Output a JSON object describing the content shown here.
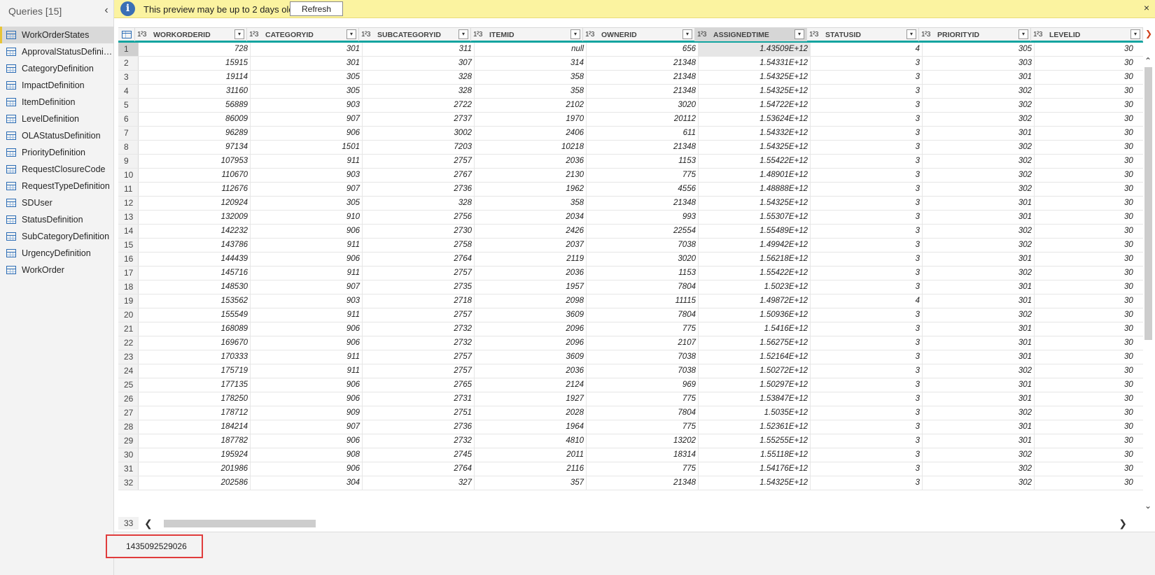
{
  "queries_header": "Queries [15]",
  "queries": [
    "WorkOrderStates",
    "ApprovalStatusDefiniti...",
    "CategoryDefinition",
    "ImpactDefinition",
    "ItemDefinition",
    "LevelDefinition",
    "OLAStatusDefinition",
    "PriorityDefinition",
    "RequestClosureCode",
    "RequestTypeDefinition",
    "SDUser",
    "StatusDefinition",
    "SubCategoryDefinition",
    "UrgencyDefinition",
    "WorkOrder"
  ],
  "selected_query": "WorkOrderStates",
  "info_bar": {
    "text": "This preview may be up to 2 days old.",
    "refresh_label": "Refresh",
    "close_glyph": "×"
  },
  "columns": [
    "WORKORDERID",
    "CATEGORYID",
    "SUBCATEGORYID",
    "ITEMID",
    "OWNERID",
    "ASSIGNEDTIME",
    "STATUSID",
    "PRIORITYID",
    "LEVELID"
  ],
  "active_column": "ASSIGNEDTIME",
  "type_glyph": "1²3",
  "rows": [
    [
      "1",
      "728",
      "301",
      "311",
      "null",
      "656",
      "1.43509E+12",
      "4",
      "305",
      "30"
    ],
    [
      "2",
      "15915",
      "301",
      "307",
      "314",
      "21348",
      "1.54331E+12",
      "3",
      "303",
      "30"
    ],
    [
      "3",
      "19114",
      "305",
      "328",
      "358",
      "21348",
      "1.54325E+12",
      "3",
      "301",
      "30"
    ],
    [
      "4",
      "31160",
      "305",
      "328",
      "358",
      "21348",
      "1.54325E+12",
      "3",
      "302",
      "30"
    ],
    [
      "5",
      "56889",
      "903",
      "2722",
      "2102",
      "3020",
      "1.54722E+12",
      "3",
      "302",
      "30"
    ],
    [
      "6",
      "86009",
      "907",
      "2737",
      "1970",
      "20112",
      "1.53624E+12",
      "3",
      "302",
      "30"
    ],
    [
      "7",
      "96289",
      "906",
      "3002",
      "2406",
      "611",
      "1.54332E+12",
      "3",
      "301",
      "30"
    ],
    [
      "8",
      "97134",
      "1501",
      "7203",
      "10218",
      "21348",
      "1.54325E+12",
      "3",
      "302",
      "30"
    ],
    [
      "9",
      "107953",
      "911",
      "2757",
      "2036",
      "1153",
      "1.55422E+12",
      "3",
      "302",
      "30"
    ],
    [
      "10",
      "110670",
      "903",
      "2767",
      "2130",
      "775",
      "1.48901E+12",
      "3",
      "302",
      "30"
    ],
    [
      "11",
      "112676",
      "907",
      "2736",
      "1962",
      "4556",
      "1.48888E+12",
      "3",
      "302",
      "30"
    ],
    [
      "12",
      "120924",
      "305",
      "328",
      "358",
      "21348",
      "1.54325E+12",
      "3",
      "301",
      "30"
    ],
    [
      "13",
      "132009",
      "910",
      "2756",
      "2034",
      "993",
      "1.55307E+12",
      "3",
      "301",
      "30"
    ],
    [
      "14",
      "142232",
      "906",
      "2730",
      "2426",
      "22554",
      "1.55489E+12",
      "3",
      "302",
      "30"
    ],
    [
      "15",
      "143786",
      "911",
      "2758",
      "2037",
      "7038",
      "1.49942E+12",
      "3",
      "302",
      "30"
    ],
    [
      "16",
      "144439",
      "906",
      "2764",
      "2119",
      "3020",
      "1.56218E+12",
      "3",
      "301",
      "30"
    ],
    [
      "17",
      "145716",
      "911",
      "2757",
      "2036",
      "1153",
      "1.55422E+12",
      "3",
      "302",
      "30"
    ],
    [
      "18",
      "148530",
      "907",
      "2735",
      "1957",
      "7804",
      "1.5023E+12",
      "3",
      "301",
      "30"
    ],
    [
      "19",
      "153562",
      "903",
      "2718",
      "2098",
      "11115",
      "1.49872E+12",
      "4",
      "301",
      "30"
    ],
    [
      "20",
      "155549",
      "911",
      "2757",
      "3609",
      "7804",
      "1.50936E+12",
      "3",
      "302",
      "30"
    ],
    [
      "21",
      "168089",
      "906",
      "2732",
      "2096",
      "775",
      "1.5416E+12",
      "3",
      "301",
      "30"
    ],
    [
      "22",
      "169670",
      "906",
      "2732",
      "2096",
      "2107",
      "1.56275E+12",
      "3",
      "301",
      "30"
    ],
    [
      "23",
      "170333",
      "911",
      "2757",
      "3609",
      "7038",
      "1.52164E+12",
      "3",
      "301",
      "30"
    ],
    [
      "24",
      "175719",
      "911",
      "2757",
      "2036",
      "7038",
      "1.50272E+12",
      "3",
      "302",
      "30"
    ],
    [
      "25",
      "177135",
      "906",
      "2765",
      "2124",
      "969",
      "1.50297E+12",
      "3",
      "301",
      "30"
    ],
    [
      "26",
      "178250",
      "906",
      "2731",
      "1927",
      "775",
      "1.53847E+12",
      "3",
      "301",
      "30"
    ],
    [
      "27",
      "178712",
      "909",
      "2751",
      "2028",
      "7804",
      "1.5035E+12",
      "3",
      "302",
      "30"
    ],
    [
      "28",
      "184214",
      "907",
      "2736",
      "1964",
      "775",
      "1.52361E+12",
      "3",
      "301",
      "30"
    ],
    [
      "29",
      "187782",
      "906",
      "2732",
      "4810",
      "13202",
      "1.55255E+12",
      "3",
      "301",
      "30"
    ],
    [
      "30",
      "195924",
      "908",
      "2745",
      "2011",
      "18314",
      "1.55118E+12",
      "3",
      "302",
      "30"
    ],
    [
      "31",
      "201986",
      "906",
      "2764",
      "2116",
      "775",
      "1.54176E+12",
      "3",
      "302",
      "30"
    ],
    [
      "32",
      "202586",
      "304",
      "327",
      "357",
      "21348",
      "1.54325E+12",
      "3",
      "302",
      "30"
    ]
  ],
  "partial_row_number": "33",
  "selected_value": "1435092529026",
  "scroll_glyphs": {
    "left": "❮",
    "right": "❯",
    "up": "⌃",
    "down": "⌄",
    "col_right": "❯"
  }
}
